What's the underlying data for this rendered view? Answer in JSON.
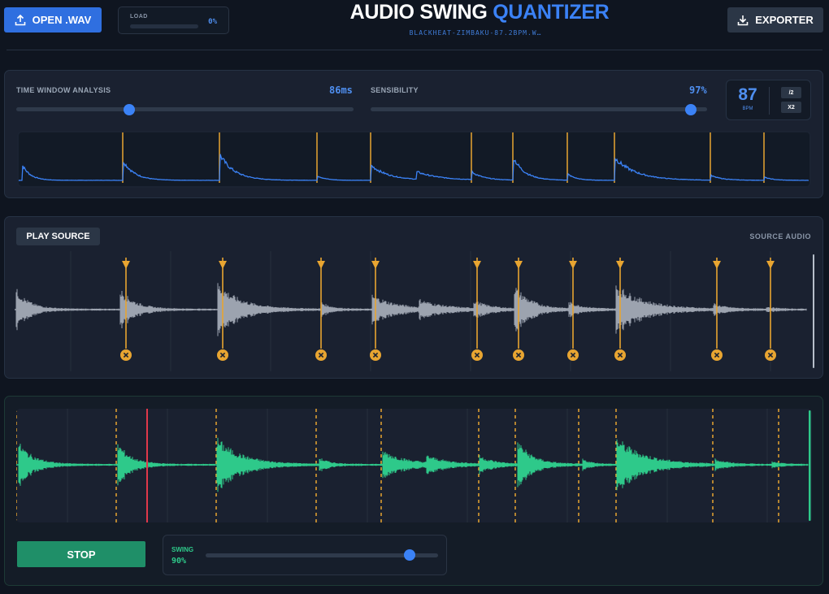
{
  "header": {
    "open_label": "OPEN .WAV",
    "load_label": "LOAD",
    "load_value": "0%",
    "load_progress": 0,
    "title_main": "AUDIO SWING ",
    "title_accent": "QUANTIZER",
    "subtitle": "BLACKHEAT-ZIMBAKU-87.2BPM.W…",
    "export_label": "EXPORTER"
  },
  "analysis": {
    "time_window_label": "TIME WINDOW ANALYSIS",
    "time_window_value": "86ms",
    "time_window_level": 0.34,
    "sensibility_label": "SENSIBILITY",
    "sensibility_value": "97%",
    "sensibility_level": 0.97,
    "bpm_value": "87",
    "bpm_unit": "BPM",
    "half_label": "/2",
    "double_label": "X2"
  },
  "source": {
    "play_label": "PLAY SOURCE",
    "title": "SOURCE AUDIO"
  },
  "output": {
    "stop_label": "STOP",
    "swing_label": "SWING",
    "swing_value": "90%",
    "swing_level": 0.9
  },
  "colors": {
    "accent": "#3b82f6",
    "marker": "#e8a531",
    "source_wave": "#9ca3af",
    "output_wave": "#2ec98a",
    "playhead": "#e0384a"
  }
}
